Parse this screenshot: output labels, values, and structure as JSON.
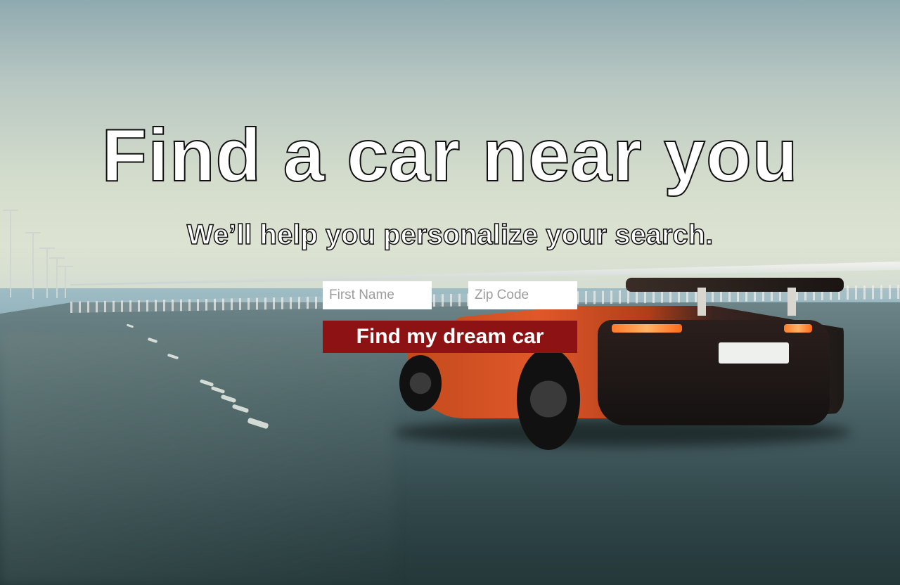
{
  "hero": {
    "title": "Find a car near you",
    "subtitle": "We’ll help you personalize your search."
  },
  "form": {
    "first_name_placeholder": "First Name",
    "zip_code_placeholder": "Zip Code",
    "first_name_value": "",
    "zip_code_value": "",
    "submit_label": "Find my dream car"
  },
  "colors": {
    "cta_background": "#8c1214",
    "cta_text": "#ffffff",
    "hero_text": "#ffffff",
    "hero_outline": "#111111"
  },
  "background": {
    "icon": "sports-car-on-highway-photo"
  }
}
